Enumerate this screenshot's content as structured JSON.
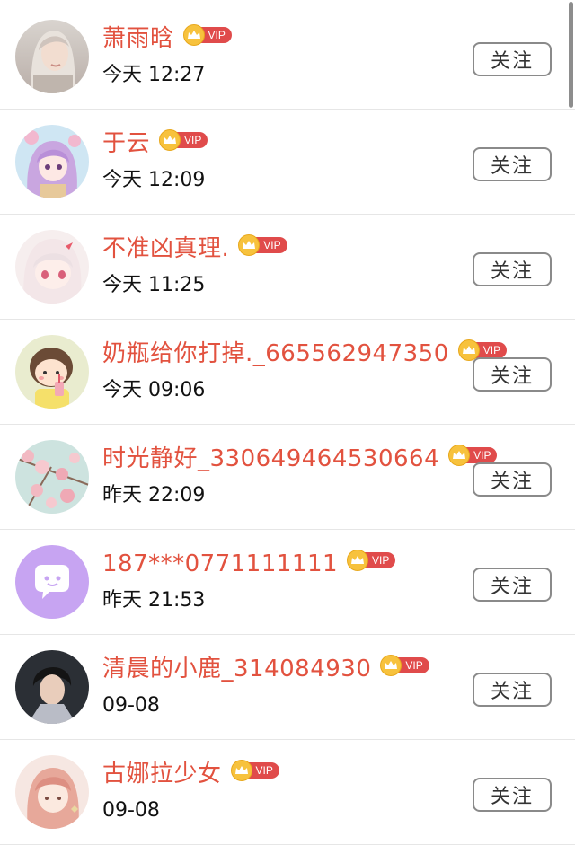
{
  "follow_label": "关注",
  "vip_label": "VIP",
  "users": [
    {
      "name": "萧雨晗",
      "time": "今天 12:27",
      "avatar": "photo-girl"
    },
    {
      "name": "于云",
      "time": "今天 12:09",
      "avatar": "anime-pink"
    },
    {
      "name": "不准凶真理.",
      "time": "今天 11:25",
      "avatar": "anime-white"
    },
    {
      "name": "奶瓶给你打掉._665562947350",
      "time": "今天 09:06",
      "avatar": "cartoon-girl"
    },
    {
      "name": "时光静好_330649464530664",
      "time": "昨天 22:09",
      "avatar": "blossoms"
    },
    {
      "name": "187***0771111111",
      "time": "昨天 21:53",
      "avatar": "chat-bubble-purple"
    },
    {
      "name": "清晨的小鹿_314084930",
      "time": "09-08",
      "avatar": "anime-man"
    },
    {
      "name": "古娜拉少女",
      "time": "09-08",
      "avatar": "sketch-girl"
    }
  ],
  "colors": {
    "name": "#e2523f",
    "vip_tag": "#e04b4b",
    "crown": "#f7c23d"
  }
}
